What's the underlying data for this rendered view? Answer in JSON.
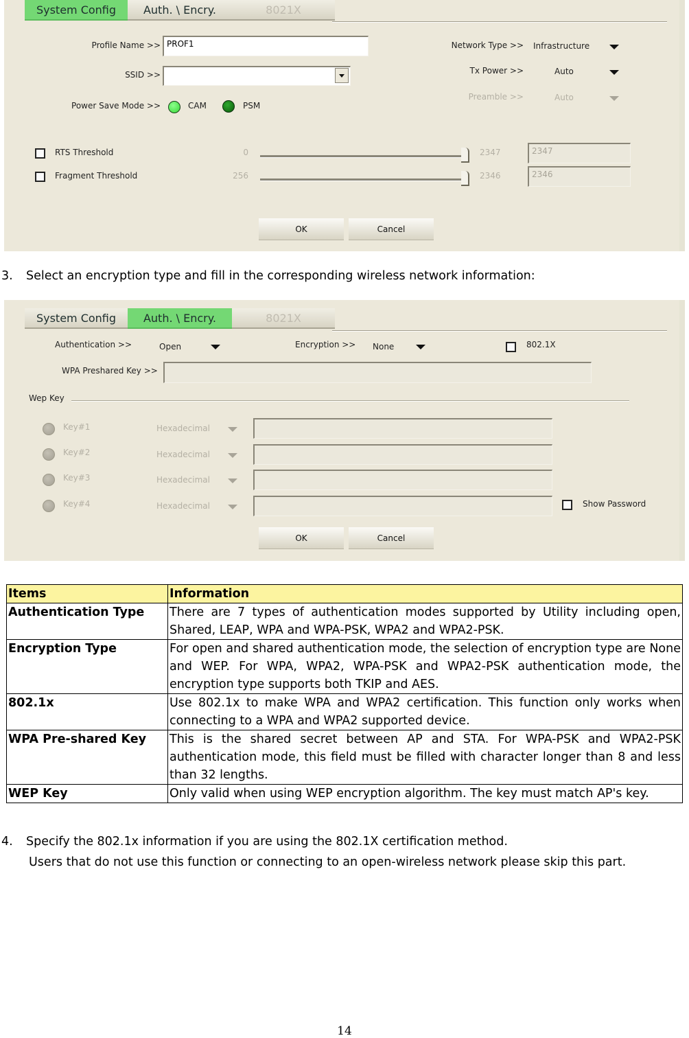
{
  "dialog1": {
    "tabs": [
      {
        "label": "System Config",
        "state": "active"
      },
      {
        "label": "Auth. \\ Encry.",
        "state": "normal"
      },
      {
        "label": "8021X",
        "state": "disabled"
      }
    ],
    "profile_name": {
      "label": "Profile Name >>",
      "value": "PROF1"
    },
    "ssid": {
      "label": "SSID >>",
      "value": ""
    },
    "power_save_mode": {
      "label": "Power Save Mode >>",
      "options": [
        "CAM",
        "PSM"
      ],
      "selected": "PSM"
    },
    "network_type": {
      "label": "Network Type >>",
      "value": "Infrastructure"
    },
    "tx_power": {
      "label": "Tx Power >>",
      "value": "Auto"
    },
    "preamble": {
      "label": "Preamble >>",
      "value": "Auto",
      "disabled": true
    },
    "rts_threshold": {
      "label": "RTS Threshold",
      "checked": false,
      "min": "0",
      "max": "2347",
      "value": "2347"
    },
    "fragment_threshold": {
      "label": "Fragment Threshold",
      "checked": false,
      "min": "256",
      "max": "2346",
      "value": "2346"
    },
    "ok_label": "OK",
    "cancel_label": "Cancel"
  },
  "step3": {
    "number": "3.",
    "text": "Select an encryption type and fill in the corresponding wireless network information:"
  },
  "dialog2": {
    "tabs": [
      {
        "label": "System Config",
        "state": "normal"
      },
      {
        "label": "Auth. \\ Encry.",
        "state": "active"
      },
      {
        "label": "8021X",
        "state": "disabled"
      }
    ],
    "authentication": {
      "label": "Authentication >>",
      "value": "Open"
    },
    "encryption": {
      "label": "Encryption >>",
      "value": "None"
    },
    "dot1x": {
      "label": "802.1X",
      "checked": false
    },
    "wpa_psk": {
      "label": "WPA Preshared Key >>",
      "value": ""
    },
    "wep_group_label": "Wep Key",
    "wep_keys": [
      {
        "label": "Key#1",
        "format": "Hexadecimal",
        "value": ""
      },
      {
        "label": "Key#2",
        "format": "Hexadecimal",
        "value": ""
      },
      {
        "label": "Key#3",
        "format": "Hexadecimal",
        "value": ""
      },
      {
        "label": "Key#4",
        "format": "Hexadecimal",
        "value": ""
      }
    ],
    "show_password": {
      "label": "Show Password",
      "checked": false
    },
    "ok_label": "OK",
    "cancel_label": "Cancel"
  },
  "table": {
    "headers": [
      "Items",
      "Information"
    ],
    "rows": [
      {
        "item": "Authentication Type",
        "info": "There are 7 types of authentication modes supported by Utility including open, Shared, LEAP, WPA and WPA-PSK, WPA2 and WPA2-PSK."
      },
      {
        "item": "Encryption Type",
        "info": "For open and shared authentication mode, the selection of encryption type are None and WEP. For WPA, WPA2, WPA-PSK and WPA2-PSK authentication mode, the encryption type supports both TKIP and AES."
      },
      {
        "item": "802.1x",
        "info": "Use 802.1x to make WPA and WPA2 certification. This function only works when connecting to a WPA and WPA2 supported device."
      },
      {
        "item": "WPA Pre-shared Key",
        "info": "This is the shared secret between AP and STA. For WPA-PSK and WPA2-PSK authentication mode, this field must be filled with character longer than 8 and less than 32 lengths."
      },
      {
        "item": "WEP Key",
        "info": "Only valid when using WEP encryption algorithm. The key must match AP's key."
      }
    ]
  },
  "step4": {
    "number": "4.",
    "text": "Specify the 802.1x information if you are using the 802.1X certification method.",
    "note": "Users that do not use this function or connecting to an open-wireless network please skip this part."
  },
  "page_number": "14",
  "colors": {
    "active_tab": "#74d874",
    "panel_bg": "#ece8da",
    "table_header": "#fcf4a0"
  }
}
